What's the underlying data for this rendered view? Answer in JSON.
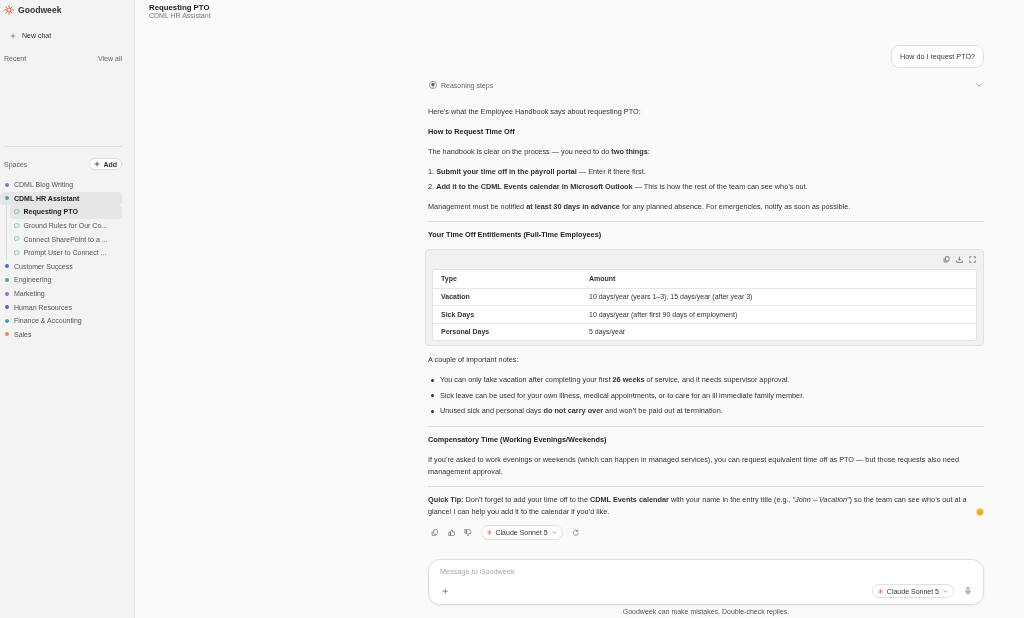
{
  "sidebar": {
    "app_name": "Goodweek",
    "new_chat": "New chat",
    "recent": {
      "label": "Recent",
      "view_all": "View all"
    },
    "spaces": {
      "label": "Spaces",
      "add": "Add",
      "items": [
        {
          "name": "CDML Blog Writing",
          "color": "#9c6ad8",
          "selected": false
        },
        {
          "name": "CDML HR Assistant",
          "color": "#3aa9c0",
          "selected": true,
          "children": [
            {
              "title": "Requesting PTO",
              "selected": true
            },
            {
              "title": "Ground Rules for Our Co...",
              "selected": false
            },
            {
              "title": "Connect SharePoint to a ...",
              "selected": false
            },
            {
              "title": "Prompt User to Connect ...",
              "selected": false
            }
          ]
        },
        {
          "name": "Customer Success",
          "color": "#4a6cd4",
          "selected": false
        },
        {
          "name": "Engineering",
          "color": "#4bae7c",
          "selected": false
        },
        {
          "name": "Marketing",
          "color": "#b35fd0",
          "selected": false
        },
        {
          "name": "Human Resources",
          "color": "#7057d0",
          "selected": false
        },
        {
          "name": "Finance & Accounting",
          "color": "#3fa7a7",
          "selected": false
        },
        {
          "name": "Sales",
          "color": "#ee8a4a",
          "selected": false
        }
      ]
    }
  },
  "header": {
    "title": "Requesting PTO",
    "subtitle": "CDML HR Assistant"
  },
  "conversation": {
    "user_message": "How do I request PTO?",
    "reasoning": {
      "label": "Reasoning steps",
      "expanded": false
    },
    "answer": [
      {
        "kind": "paragraph",
        "text": "Here’s what the Employee Handbook says about requesting PTO:"
      },
      {
        "kind": "heading",
        "text": "How to Request Time Off"
      },
      {
        "kind": "paragraph",
        "text": "The handbook is clear on the process — you need to do **two things**:"
      },
      {
        "kind": "numbered_list",
        "items": [
          "1. **Submit your time off in the payroll portal** — Enter it there first.",
          "2. **Add it to the CDML Events calendar in Microsoft Outlook** — This is how the rest of the team can see who’s out."
        ]
      },
      {
        "kind": "paragraph",
        "text": "Management must be notified **at least 30 days in advance** for any planned absence. For emergencies, notify as soon as possible."
      },
      {
        "kind": "divider"
      },
      {
        "kind": "heading",
        "text": "Your Time Off Entitlements (Full-Time Employees)"
      },
      {
        "kind": "table",
        "columns": [
          "Type",
          "Amount"
        ],
        "rows": [
          [
            "Vacation",
            "10 days/year (years 1–3), 15 days/year (after year 3)"
          ],
          [
            "Sick Days",
            "10 days/year (after first 90 days of employment)"
          ],
          [
            "Personal Days",
            "5 days/year"
          ]
        ]
      },
      {
        "kind": "paragraph",
        "text": "A couple of important notes:"
      },
      {
        "kind": "bullet_list",
        "items": [
          "You can only take vacation after completing your first **26 weeks** of service, and it needs supervisor approval.",
          "Sick leave can be used for your own illness, medical appointments, or to care for an ill immediate family member.",
          "Unused sick and personal days **do not carry over** and won’t be paid out at termination."
        ]
      },
      {
        "kind": "divider"
      },
      {
        "kind": "heading",
        "text": "Compensatory Time (Working Evenings/Weekends)"
      },
      {
        "kind": "paragraph",
        "text": "If you’re asked to work evenings or weekends (which can happen in managed services), you can request equivalent time off as PTO — but those requests also need management approval."
      },
      {
        "kind": "divider"
      },
      {
        "kind": "closing",
        "text": "**Quick Tip:** Don’t forget to add your time off to the **CDML Events calendar** with your name in the entry title (e.g., *“John – Vacation”*) so the team can see who’s out at a glance! I can help you add it to the calendar if you’d like."
      }
    ],
    "actions": {
      "model": "Claude Sonnet 5"
    }
  },
  "composer": {
    "placeholder": "Message to Goodweek",
    "model": "Claude Sonnet 5"
  },
  "footer_note": "Goodweek can make mistakes. Double-check replies."
}
